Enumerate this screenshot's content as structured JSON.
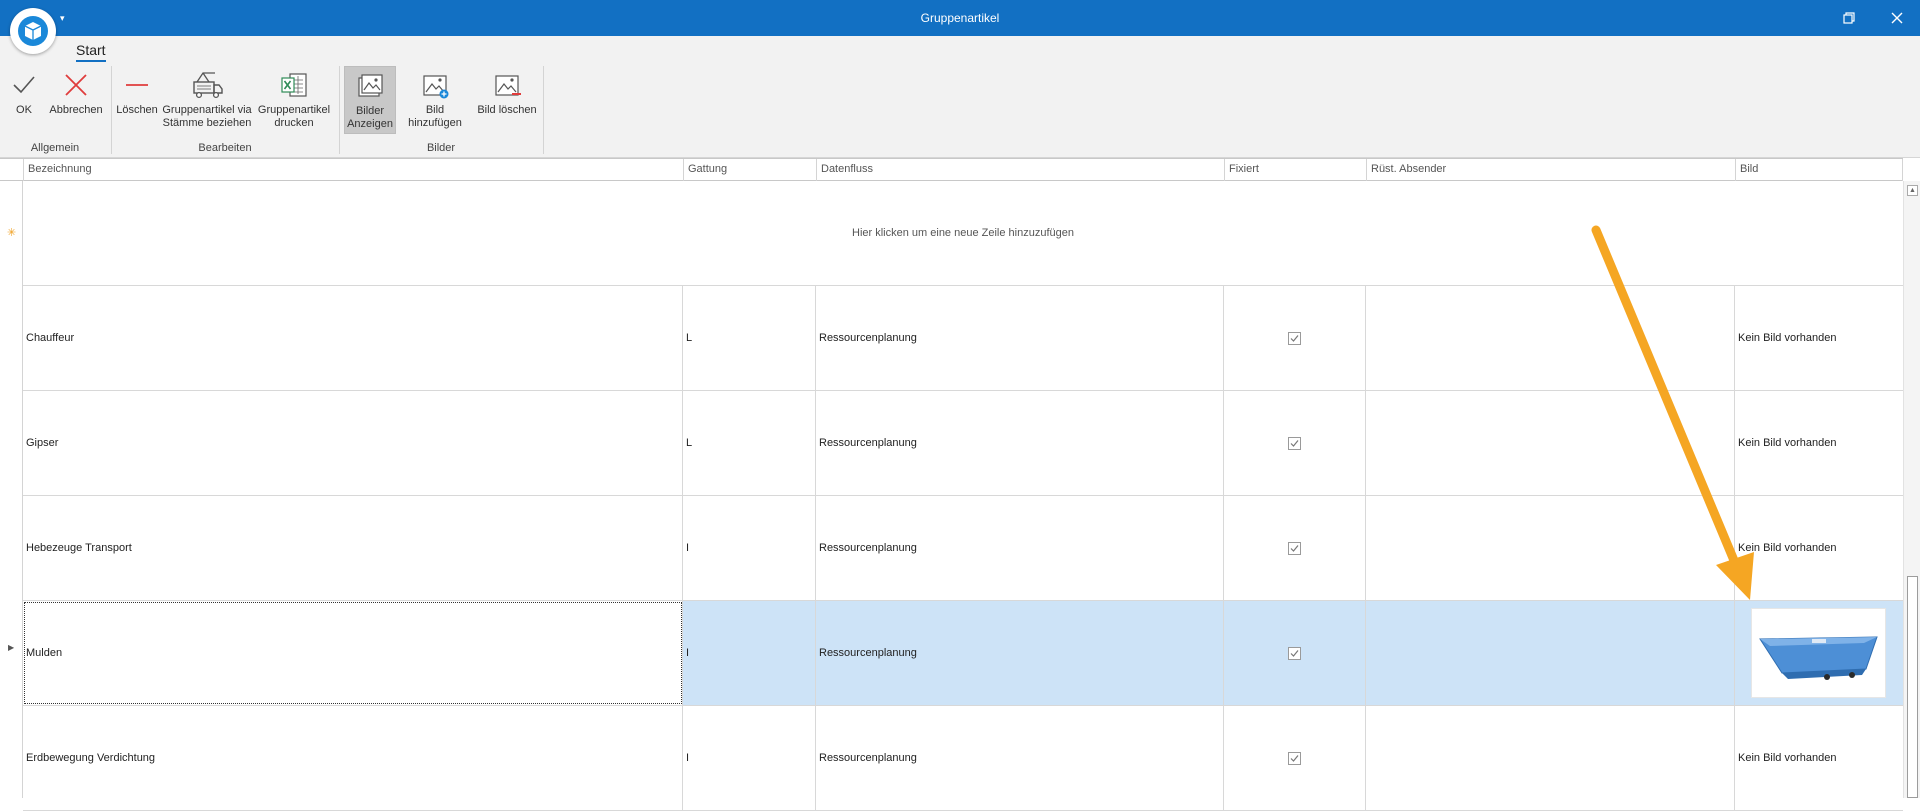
{
  "window": {
    "title": "Gruppenartikel"
  },
  "ribbon": {
    "tab": "Start",
    "groups": {
      "allgemein": {
        "label": "Allgemein",
        "ok": "OK",
        "cancel": "Abbrechen"
      },
      "bearbeiten": {
        "label": "Bearbeiten",
        "delete": "Löschen",
        "via_line1": "Gruppenartikel via",
        "via_line2": "Stämme beziehen",
        "print_line1": "Gruppenartikel",
        "print_line2": "drucken"
      },
      "bilder": {
        "label": "Bilder",
        "show_line1": "Bilder",
        "show_line2": "Anzeigen",
        "add": "Bild hinzufügen",
        "delete": "Bild löschen"
      }
    }
  },
  "grid": {
    "columns": [
      "Bezeichnung",
      "Gattung",
      "Datenfluss",
      "Fixiert",
      "Rüst. Absender",
      "Bild"
    ],
    "new_row_text": "Hier klicken um eine neue Zeile hinzuzufügen",
    "no_image_text": "Kein Bild vorhanden",
    "rows": [
      {
        "bezeichnung": "Chauffeur",
        "gattung": "L",
        "datenfluss": "Ressourcenplanung",
        "fixiert": true,
        "bild": "Kein Bild vorhanden"
      },
      {
        "bezeichnung": "Gipser",
        "gattung": "L",
        "datenfluss": "Ressourcenplanung",
        "fixiert": true,
        "bild": "Kein Bild vorhanden"
      },
      {
        "bezeichnung": "Hebezeuge Transport",
        "gattung": "I",
        "datenfluss": "Ressourcenplanung",
        "fixiert": true,
        "bild": "Kein Bild vorhanden"
      },
      {
        "bezeichnung": "Mulden",
        "gattung": "I",
        "datenfluss": "Ressourcenplanung",
        "fixiert": true,
        "bild": ""
      },
      {
        "bezeichnung": "Erdbewegung Verdichtung",
        "gattung": "I",
        "datenfluss": "Ressourcenplanung",
        "fixiert": true,
        "bild": "Kein Bild vorhanden"
      }
    ],
    "selected_row": "Mulden"
  },
  "colors": {
    "titlebar": "#1270c3",
    "selected_row": "#cde3f7",
    "annotation_arrow": "#f5a623"
  }
}
